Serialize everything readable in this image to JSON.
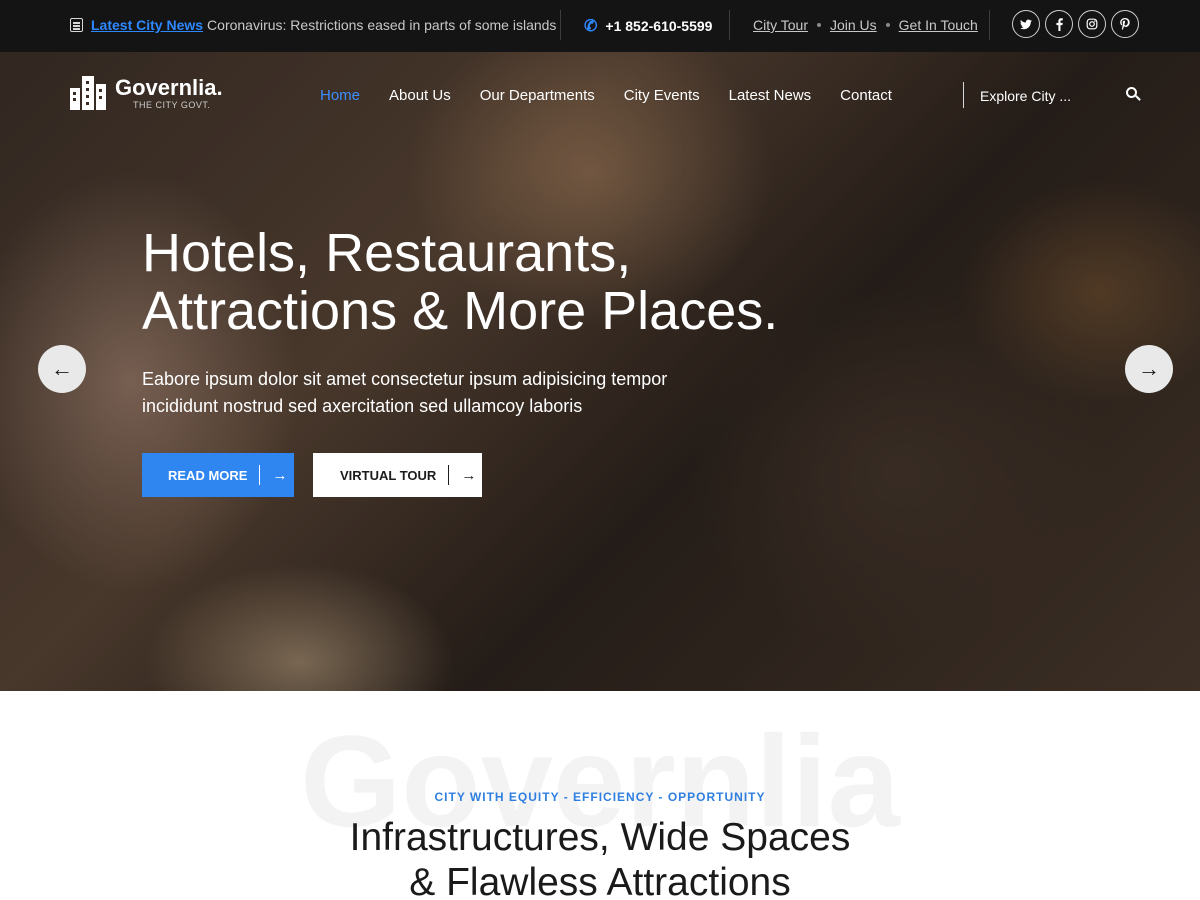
{
  "topbar": {
    "news_label": "Latest City News",
    "news_text": "Coronavirus: Restrictions eased in parts of some islands",
    "phone": "+1 852-610-5599",
    "links": [
      "City Tour",
      "Join Us",
      "Get In Touch"
    ],
    "social": [
      "twitter-icon",
      "facebook-icon",
      "instagram-icon",
      "pinterest-icon"
    ]
  },
  "nav": {
    "logo_name": "Governlia.",
    "logo_tagline": "THE CITY GOVT.",
    "items": [
      "Home",
      "About Us",
      "Our Departments",
      "City Events",
      "Latest News",
      "Contact"
    ],
    "active_item": "Home",
    "explore_label": "Explore City ..."
  },
  "hero": {
    "headline_line1": "Hotels, Restaurants,",
    "headline_line2": "Attractions & More Places.",
    "subtext_line1": "Eabore ipsum dolor sit amet consectetur ipsum adipisicing tempor",
    "subtext_line2": "incididunt nostrud sed axercitation sed ullamcoy laboris",
    "primary_button": "READ MORE",
    "secondary_button": "VIRTUAL TOUR",
    "arrow_glyph": "→",
    "prev_glyph": "←",
    "next_glyph": "→"
  },
  "intro": {
    "watermark": "Governlia",
    "eyebrow": "CITY WITH EQUITY - EFFICIENCY - OPPORTUNITY",
    "title_line1": "Infrastructures, Wide Spaces",
    "title_line2": "& Flawless Attractions"
  },
  "colors": {
    "accent": "#2f86f0",
    "topbar_bg": "#141414",
    "active_nav": "#3b8eff"
  }
}
